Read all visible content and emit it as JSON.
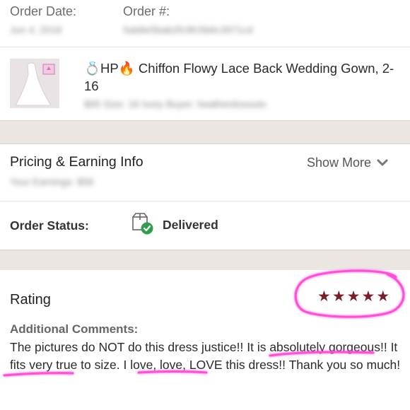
{
  "order": {
    "date_label": "Order Date:",
    "number_label": "Order #:",
    "date_value": "Jun 4, 2018",
    "number_value": "5ab8e5bab2fc9fc5b6c3971cd"
  },
  "item": {
    "title_emoji_ring": "💍",
    "title_hp": "HP",
    "title_emoji_fire": "🔥",
    "title_text": " Chiffon Flowy Lace Back Wedding Gown, 2-16",
    "details": "$95  Size: 16 Ivory  Buyer: heatherdosouto"
  },
  "pricing": {
    "title": "Pricing & Earning Info",
    "earnings": "Your Earnings: $56",
    "show_more": "Show More"
  },
  "status": {
    "label": "Order Status:",
    "value": "Delivered"
  },
  "rating": {
    "title": "Rating",
    "stars": 5,
    "comments_label": "Additional Comments:",
    "comment_parts": [
      "The pictures do NOT do this dress justice!! ",
      "It is absolutely",
      " ",
      "gorgeous",
      "!! It fits very ",
      "true to size",
      ". I love, love, LOVE this dress!! Thank you so much!"
    ]
  },
  "colors": {
    "star": "#7a1e2a",
    "highlight": "#ff4fd8",
    "delivered_check": "#2e9e4f"
  }
}
